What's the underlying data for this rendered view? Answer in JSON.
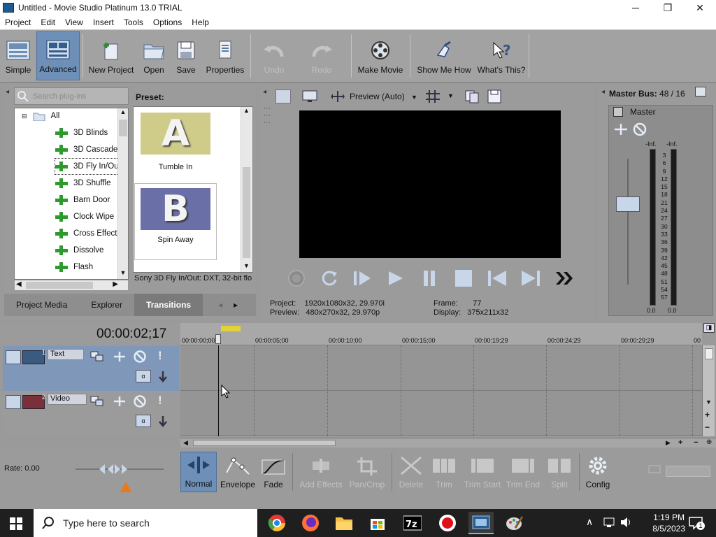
{
  "window": {
    "title": "Untitled - Movie Studio Platinum 13.0 TRIAL",
    "minimize": "─",
    "maximize": "❐",
    "close": "✕"
  },
  "menu": [
    "Project",
    "Edit",
    "View",
    "Insert",
    "Tools",
    "Options",
    "Help"
  ],
  "toolbar": {
    "simple": "Simple",
    "advanced": "Advanced",
    "new_project": "New Project",
    "open": "Open",
    "save": "Save",
    "properties": "Properties",
    "undo": "Undo",
    "redo": "Redo",
    "make_movie": "Make Movie",
    "show_me_how": "Show Me How",
    "whats_this": "What's This?"
  },
  "plugins": {
    "search_placeholder": "Search plug-ins",
    "tree": [
      "All",
      "3D Blinds",
      "3D Cascade",
      "3D Fly In/Out",
      "3D Shuffle",
      "Barn Door",
      "Clock Wipe",
      "Cross Effect",
      "Dissolve",
      "Flash"
    ],
    "preset_label": "Preset:",
    "presets": [
      {
        "letter": "A",
        "name": "Tumble In"
      },
      {
        "letter": "B",
        "name": "Spin Away"
      }
    ],
    "status": "Sony 3D Fly In/Out: DXT, 32-bit flo"
  },
  "tabs": [
    "Project Media",
    "Explorer",
    "Transitions"
  ],
  "preview": {
    "mode": "Preview (Auto)",
    "project_label": "Project:",
    "project_value": "1920x1080x32, 29.970i",
    "preview_label": "Preview:",
    "preview_value": "480x270x32, 29.970p",
    "frame_label": "Frame:",
    "frame_value": "77",
    "display_label": "Display:",
    "display_value": "375x211x32"
  },
  "master": {
    "title": "Master Bus:",
    "count": "48 / 16",
    "label": "Master",
    "inf_left": "-Inf.",
    "inf_right": "-Inf.",
    "scale": [
      "3",
      "6",
      "9",
      "12",
      "15",
      "18",
      "21",
      "24",
      "27",
      "30",
      "33",
      "36",
      "39",
      "42",
      "45",
      "48",
      "51",
      "54",
      "57"
    ],
    "bottom_left": "0.0",
    "bottom_right": "0.0"
  },
  "timeline": {
    "timecode": "00:00:02;17",
    "ruler": [
      "00:00:00;00",
      "00:00:05;00",
      "00:00:10;00",
      "00:00:15;00",
      "00:00:19;29",
      "00:00:24;29",
      "00:00:29;29",
      "00"
    ],
    "tracks": [
      {
        "number": "1",
        "name": "Text"
      },
      {
        "number": "2",
        "name": "Video"
      }
    ]
  },
  "bottom": {
    "rate": "Rate: 0.00",
    "normal": "Normal",
    "envelope": "Envelope",
    "fade": "Fade",
    "add_effects": "Add Effects",
    "pan_crop": "Pan/Crop",
    "delete": "Delete",
    "trim": "Trim",
    "trim_start": "Trim Start",
    "trim_end": "Trim End",
    "split": "Split",
    "config": "Config"
  },
  "taskbar": {
    "search_placeholder": "Type here to search",
    "time": "1:19 PM",
    "date": "8/5/2023",
    "notification_count": "1"
  },
  "colors": {
    "accent": "#3c6fa8",
    "selected": "#5b8fd0",
    "panel": "#9b9b9b"
  }
}
